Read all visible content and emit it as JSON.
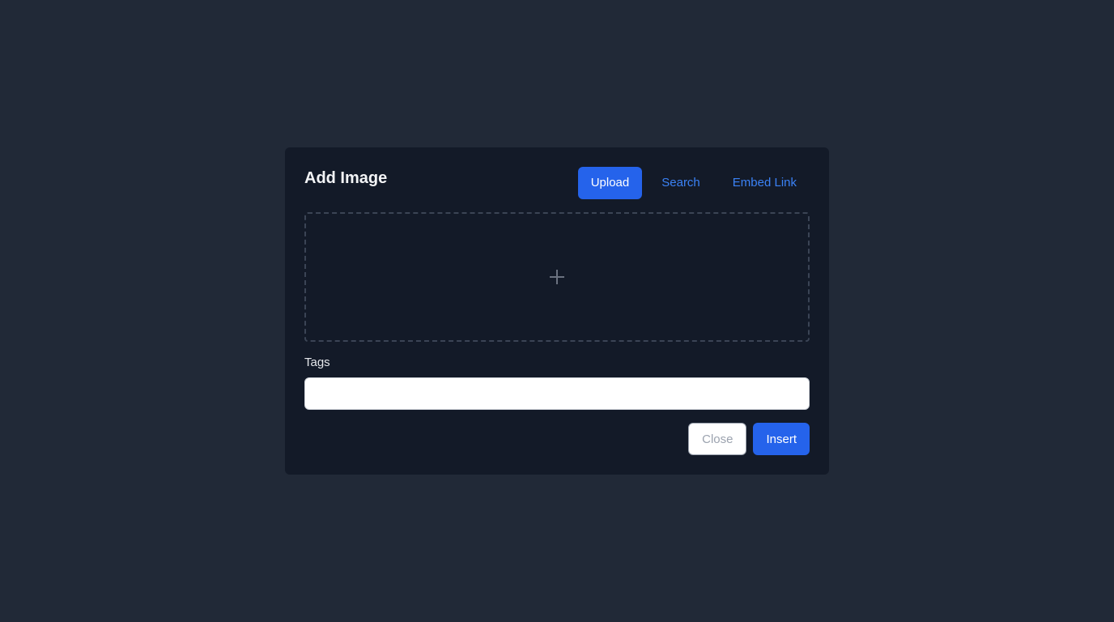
{
  "dialog": {
    "title": "Add Image",
    "tabs": [
      {
        "label": "Upload",
        "active": true
      },
      {
        "label": "Search",
        "active": false
      },
      {
        "label": "Embed Link",
        "active": false
      }
    ],
    "dropzone": {
      "icon": "plus-icon"
    },
    "tags": {
      "label": "Tags",
      "value": "",
      "placeholder": ""
    },
    "footer": {
      "close_label": "Close",
      "insert_label": "Insert"
    }
  },
  "colors": {
    "page_background": "#212937",
    "dialog_background": "#131a28",
    "accent": "#2563eb",
    "link": "#3b82f6"
  }
}
